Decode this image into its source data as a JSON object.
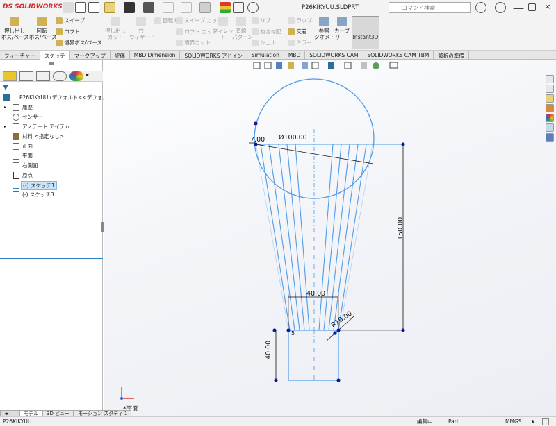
{
  "app": {
    "logo": "SOLIDWORKS",
    "file_name": "P26KIKYUU.SLDPRT"
  },
  "search": {
    "placeholder": "コマンド検索"
  },
  "commands": [
    {
      "id": "extrude-boss",
      "label": "押し出し\nボス/ベース",
      "enabled": true
    },
    {
      "id": "revolve-boss",
      "label": "回転\nボス/ベース",
      "enabled": true
    },
    {
      "id": "sweep",
      "label": "スイープ",
      "enabled": true
    },
    {
      "id": "loft",
      "label": "ロフト",
      "enabled": true
    },
    {
      "id": "boundary-boss",
      "label": "境界ボス/ベース",
      "enabled": true
    },
    {
      "id": "extrude-cut",
      "label": "押し出し\nカット",
      "enabled": false
    },
    {
      "id": "hole-wizard",
      "label": "穴\nウィザード",
      "enabled": false
    },
    {
      "id": "revolve-cut",
      "label": "回転カット",
      "enabled": false
    },
    {
      "id": "sweep-cut",
      "label": "スイープ カット",
      "enabled": false
    },
    {
      "id": "loft-cut",
      "label": "ロフト カット",
      "enabled": false
    },
    {
      "id": "boundary-cut",
      "label": "境界カット",
      "enabled": false
    },
    {
      "id": "fillet",
      "label": "フィレット",
      "enabled": false
    },
    {
      "id": "linear-pattern",
      "label": "直線\nパターン",
      "enabled": false
    },
    {
      "id": "rib",
      "label": "リブ",
      "enabled": false
    },
    {
      "id": "draft",
      "label": "抜き勾配",
      "enabled": false
    },
    {
      "id": "shell",
      "label": "シェル",
      "enabled": false
    },
    {
      "id": "wrap",
      "label": "ラップ",
      "enabled": false
    },
    {
      "id": "intersect",
      "label": "交差",
      "enabled": true
    },
    {
      "id": "mirror",
      "label": "ミラー",
      "enabled": false
    },
    {
      "id": "ref-geometry",
      "label": "参照\nジオメトリ",
      "enabled": true
    },
    {
      "id": "curves",
      "label": "カーブ",
      "enabled": true
    },
    {
      "id": "instant3d",
      "label": "Instant3D",
      "enabled": true
    }
  ],
  "tabs": [
    "フィーチャー",
    "スケッチ",
    "マークアップ",
    "評価",
    "MBD Dimension",
    "SOLIDWORKS アドイン",
    "Simulation",
    "MBD",
    "SOLIDWORKS CAM",
    "SOLIDWORKS CAM TBM",
    "解析の準備"
  ],
  "tree": {
    "root": "P26KIKYUU (デフォルト<<デフォルト>_表",
    "items": [
      {
        "label": "履歴",
        "icon": "history-icon",
        "expand": true
      },
      {
        "label": "センサー",
        "icon": "sensor-icon",
        "expand": false
      },
      {
        "label": "アノテート アイテム",
        "icon": "annotation-icon",
        "expand": true
      },
      {
        "label": "材料 <指定なし>",
        "icon": "material-icon",
        "expand": false
      },
      {
        "label": "正面",
        "icon": "plane-icon",
        "expand": false
      },
      {
        "label": "平面",
        "icon": "plane-icon",
        "expand": false
      },
      {
        "label": "右側面",
        "icon": "plane-icon",
        "expand": false
      },
      {
        "label": "原点",
        "icon": "origin-icon",
        "expand": false
      },
      {
        "label": "(-) スケッチ1",
        "icon": "sketch-icon",
        "expand": false,
        "selected": true
      },
      {
        "label": "(-) スケッチ3",
        "icon": "sketch-icon",
        "expand": false
      }
    ]
  },
  "sketch": {
    "dims": {
      "diameter": "Ø100.00",
      "offset": "7.00",
      "height": "150.00",
      "width_top": "40.00",
      "radius": "R10.00",
      "basket_height": "40.00",
      "small": "5"
    },
    "view_label": "*平面",
    "colors": {
      "sketch": "#4f9be8",
      "point": "#0d1a9c",
      "dim": "#111111"
    }
  },
  "bottom_tabs": [
    "モデル",
    "3D ビュー",
    "モーション スタディ 1"
  ],
  "status": {
    "part_name": "P26KIKYUU",
    "editing": "編集中：",
    "doc_type": "Part",
    "units": "MMGS"
  }
}
